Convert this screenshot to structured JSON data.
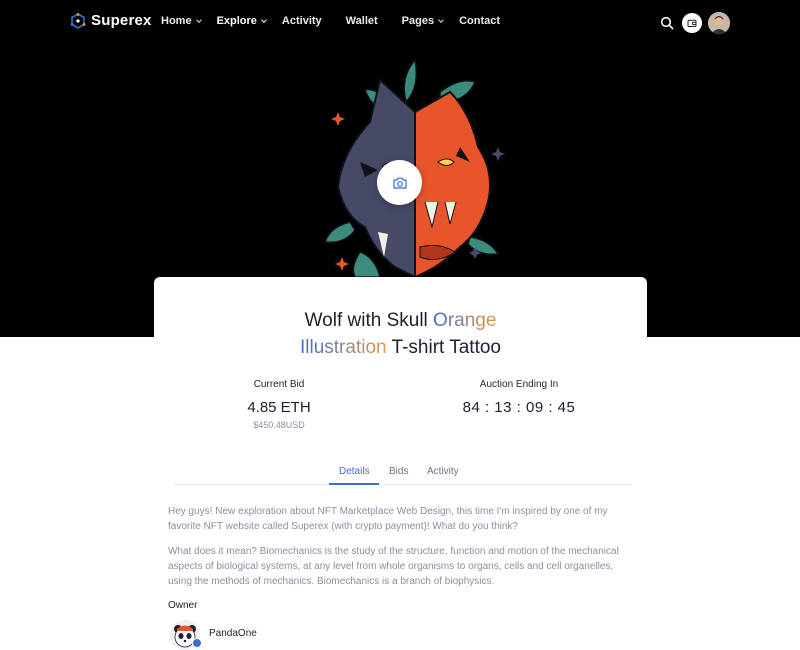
{
  "brand": {
    "name": "Superex"
  },
  "nav": {
    "items": [
      {
        "label": "Home",
        "has_dropdown": true,
        "active": false
      },
      {
        "label": "Explore",
        "has_dropdown": true,
        "active": true
      },
      {
        "label": "Activity",
        "has_dropdown": false,
        "active": false
      },
      {
        "label": "Wallet",
        "has_dropdown": false,
        "active": false
      },
      {
        "label": "Pages",
        "has_dropdown": true,
        "active": false
      },
      {
        "label": "Contact",
        "has_dropdown": false,
        "active": false
      }
    ],
    "icons": [
      "search-icon",
      "wallet-icon",
      "user-avatar"
    ]
  },
  "item": {
    "title_part1": "Wolf with Skull ",
    "title_orange": "Orange",
    "title_illustration": "Illustration",
    "title_part2": " T-shirt Tattoo",
    "current_bid_label": "Current Bid",
    "current_bid_value": "4.85 ETH",
    "current_bid_usd": "$450.48USD",
    "auction_label": "Auction Ending In",
    "auction_countdown": "84 : 13 : 09 : 45"
  },
  "tabs": [
    {
      "label": "Details",
      "active": true
    },
    {
      "label": "Bids",
      "active": false
    },
    {
      "label": "Activity",
      "active": false
    }
  ],
  "details": {
    "paragraph1": "Hey guys! New exploration about NFT Marketplace Web Design, this time I'm inspired by one of my favorite NFT website called Superex (with crypto payment)! What do you think?",
    "paragraph2": "What does it mean? Biomechanics is the study of the structure, function and motion of the mechanical aspects of biological systems, at any level from whole organisms to organs, cells and cell organelles, using the methods of mechanics. Biomechanics is a branch of biophysics.",
    "owner_label": "Owner",
    "owner_name": "PandaOne"
  },
  "colors": {
    "accent_blue": "#3b6fd0",
    "accent_orange": "#e39a3c",
    "wolf_orange": "#e8552b",
    "wolf_gray": "#474a66",
    "leaf_teal": "#3c8c7e"
  }
}
